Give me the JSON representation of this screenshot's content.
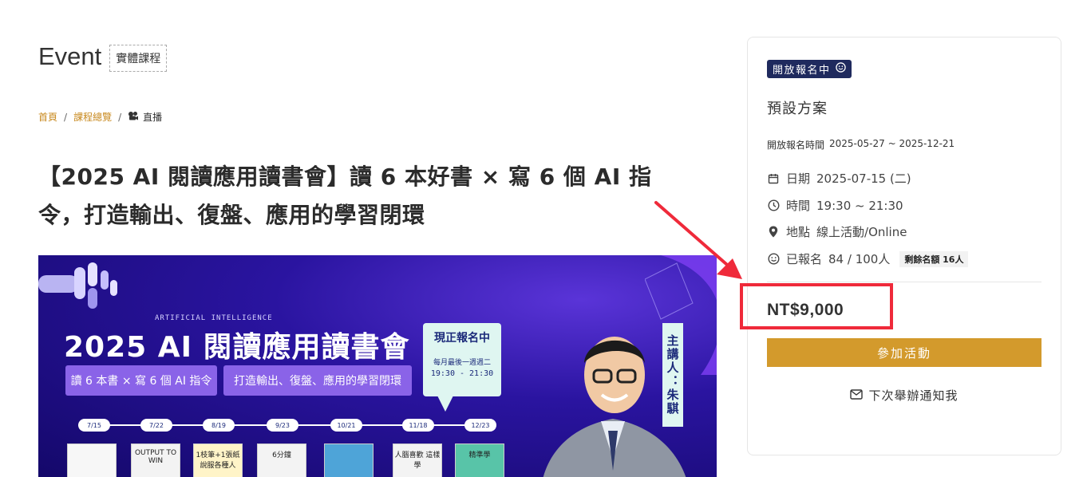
{
  "header": {
    "title": "Event",
    "type_tag": "實體課程"
  },
  "breadcrumb": {
    "home": "首頁",
    "sep": "/",
    "courses": "課程總覽",
    "current": "直播"
  },
  "course_title": "【2025 AI 閱讀應用讀書會】讀 6 本好書 × 寫 6 個 AI 指令，打造輸出、復盤、應用的學習閉環",
  "banner": {
    "small_caption": "ARTIFICIAL INTELLIGENCE",
    "heading": "2025 AI 閱讀應用讀書會",
    "pill1": "讀 6 本書 × 寫 6 個 AI 指令",
    "pill2": "打造輸出、復盤、應用的學習閉環",
    "notice_title": "現正報名中",
    "notice_sub": "每月最後一週週二",
    "notice_time": "19:30 - 21:30",
    "speaker": "主講人：朱騏",
    "dates": [
      "7/15",
      "7/22",
      "8/19",
      "9/23",
      "10/21",
      "11/18",
      "12/23"
    ],
    "books": [
      "",
      "OUTPUT TO WIN",
      "1枝筆+1張紙 說服各種人",
      "6分鐘",
      "",
      "人腦喜歡 這樣學",
      "精準學"
    ]
  },
  "sidebar": {
    "status": "開放報名中",
    "plan": "預設方案",
    "reg_label": "開放報名時間",
    "reg_range": "2025-05-27 ~ 2025-12-21",
    "date_label": "日期",
    "date_value": "2025-07-15 (二)",
    "time_label": "時間",
    "time_value": "19:30 ~ 21:30",
    "place_label": "地點",
    "place_value": "線上活動/Online",
    "count_label": "已報名",
    "count_value": "84 / 100人",
    "remaining": "剩餘名額 16人",
    "price": "NT$9,000",
    "join_button": "參加活動",
    "notify": "下次舉辦通知我"
  },
  "colors": {
    "accent": "#d39a2c",
    "link": "#c8891e",
    "badge": "#1f2a5e",
    "highlight": "#ef2a3a",
    "banner": "#2a14a0"
  },
  "icons": {
    "status": "smile-icon",
    "date": "calendar-icon",
    "time": "clock-icon",
    "place": "map-pin-icon",
    "count": "smile-icon",
    "notify": "mail-icon",
    "breadcrumb": "camera-icon"
  }
}
